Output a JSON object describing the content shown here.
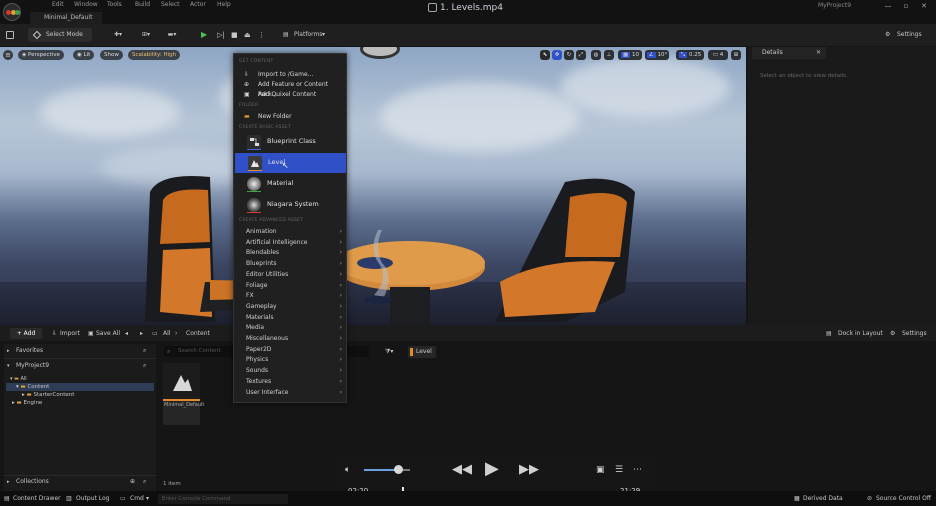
{
  "titlebar": {
    "menu": [
      "Edit",
      "Window",
      "Tools",
      "Build",
      "Select",
      "Actor",
      "Help"
    ],
    "project_tab": "Minimal_Default",
    "video_title": "1. Levels.mp4",
    "project_name": "MyProject9",
    "window_buttons": [
      "—",
      "▫",
      "✕"
    ]
  },
  "toolbar": {
    "select_mode": "Select Mode",
    "platforms": "Platforms",
    "settings": "Settings"
  },
  "viewport": {
    "perspective": "Perspective",
    "lit": "Lit",
    "show": "Show",
    "scalability": "Scalability: High",
    "grid_snap": "10",
    "rot_snap": "10°",
    "scale_snap": "0.25",
    "cam_speed": "4"
  },
  "details": {
    "tab": "Details",
    "close": "✕",
    "empty_msg": "Select an object to view details."
  },
  "context_menu": {
    "get_content_header": "GET CONTENT",
    "get_content": [
      "Import to /Game...",
      "Add Feature or Content Pack...",
      "Add Quixel Content"
    ],
    "folder_header": "FOLDER",
    "new_folder": "New Folder",
    "basic_header": "CREATE BASIC ASSET",
    "basic_assets": [
      "Blueprint Class",
      "Level",
      "Material",
      "Niagara System"
    ],
    "advanced_header": "CREATE ADVANCED ASSET",
    "advanced": [
      "Animation",
      "Artificial Intelligence",
      "Blendables",
      "Blueprints",
      "Editor Utilities",
      "Foliage",
      "FX",
      "Gameplay",
      "Materials",
      "Media",
      "Miscellaneous",
      "Paper2D",
      "Physics",
      "Sounds",
      "Textures",
      "User Interface"
    ],
    "arrow": "›"
  },
  "content_browser": {
    "add": "+ Add",
    "import": "Import",
    "save_all": "Save All",
    "path_all": "All",
    "path_content": "Content",
    "dock": "Dock in Layout",
    "settings": "Settings",
    "favorites": "Favorites",
    "project": "MyProject9",
    "tree": [
      "All",
      "Content",
      "StarterContent",
      "Engine"
    ],
    "search_placeholder": "Search Content",
    "filter_chip": "Level",
    "collections": "Collections",
    "item_count": "1 item",
    "asset_name": "Minimal_Default"
  },
  "statusbar": {
    "content_drawer": "Content Drawer",
    "output_log": "Output Log",
    "cmd": "Cmd",
    "console_placeholder": "Enter Console Command",
    "derived_data": "Derived Data",
    "source_control": "Source Control Off"
  },
  "video": {
    "current_time": "02:20",
    "duration": "21:29",
    "progress": 0.1086,
    "volume": 0.75
  },
  "colors": {
    "highlight": "#3050c8",
    "accent_orange": "#e08a2a",
    "viewport_sky": "#a8b9cf"
  }
}
